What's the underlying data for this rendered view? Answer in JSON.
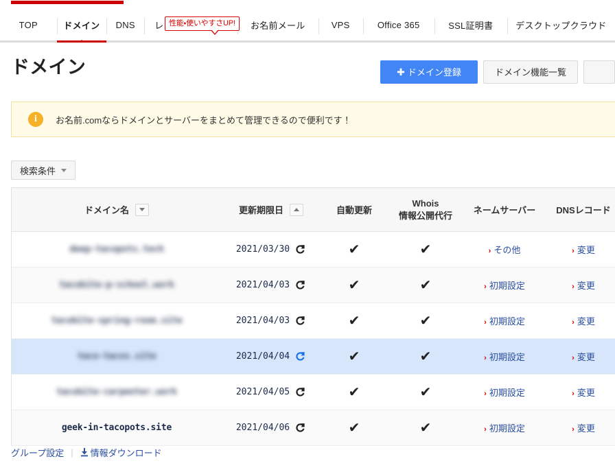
{
  "globalnav": {
    "balloon": "性能・使いやすさUP!",
    "items": [
      {
        "label": "TOP",
        "active": false
      },
      {
        "label": "ドメイン",
        "active": true
      },
      {
        "label": "DNS",
        "active": false
      },
      {
        "label": "レンタルサーバー",
        "active": false
      },
      {
        "label": "お名前メール",
        "active": false
      },
      {
        "label": "VPS",
        "active": false
      },
      {
        "label": "Office 365",
        "active": false
      },
      {
        "label": "SSL証明書",
        "active": false
      },
      {
        "label": "デスクトップクラウド",
        "active": false
      }
    ]
  },
  "header": {
    "title": "ドメイン",
    "register_button": "ドメイン登録",
    "register_plus": "✚",
    "functions_button": "ドメイン機能一覧"
  },
  "notice": {
    "icon": "i",
    "text": "お名前.comならドメインとサーバーをまとめて管理できるので便利です！"
  },
  "search": {
    "toggle_label": "検索条件"
  },
  "table": {
    "headers": {
      "domain": "ドメイン名",
      "expire": "更新期限日",
      "auto_renew": "自動更新",
      "whois_line1": "Whois",
      "whois_line2": "情報公開代行",
      "nameserver": "ネームサーバー",
      "dns_record": "DNSレコード"
    },
    "rows": [
      {
        "domain": "deep-tacopots.tech",
        "redacted": true,
        "expire": "2021/03/30",
        "renew_highlight": false,
        "auto_renew": "✔",
        "whois": "✔",
        "nameserver": "その他",
        "dns_record": "変更",
        "selected": false
      },
      {
        "domain": "tacobite-p-school.work",
        "redacted": true,
        "expire": "2021/04/03",
        "renew_highlight": false,
        "auto_renew": "✔",
        "whois": "✔",
        "nameserver": "初期設定",
        "dns_record": "変更",
        "selected": false
      },
      {
        "domain": "tacobite-spring-room.site",
        "redacted": true,
        "expire": "2021/04/03",
        "renew_highlight": false,
        "auto_renew": "✔",
        "whois": "✔",
        "nameserver": "初期設定",
        "dns_record": "変更",
        "selected": false
      },
      {
        "domain": "taco-tacos.site",
        "redacted": true,
        "expire": "2021/04/04",
        "renew_highlight": true,
        "auto_renew": "✔",
        "whois": "✔",
        "nameserver": "初期設定",
        "dns_record": "変更",
        "selected": true
      },
      {
        "domain": "tacobite-carpenter.work",
        "redacted": true,
        "expire": "2021/04/05",
        "renew_highlight": false,
        "auto_renew": "✔",
        "whois": "✔",
        "nameserver": "初期設定",
        "dns_record": "変更",
        "selected": false
      },
      {
        "domain": "geek-in-tacopots.site",
        "redacted": false,
        "expire": "2021/04/06",
        "renew_highlight": false,
        "auto_renew": "✔",
        "whois": "✔",
        "nameserver": "初期設定",
        "dns_record": "変更",
        "selected": false
      }
    ],
    "link_arrow": "›"
  },
  "footer": {
    "group_settings": "グループ設定",
    "separator": "|",
    "download": "情報ダウンロード"
  },
  "colors": {
    "brand_red": "#cc0000",
    "primary_blue": "#4285f4",
    "link_blue": "#2c4fa0",
    "notice_bg": "#fffbe6",
    "notice_border": "#f2e2a8",
    "notice_icon": "#f5b127",
    "selected_row": "#d7e6fa"
  }
}
